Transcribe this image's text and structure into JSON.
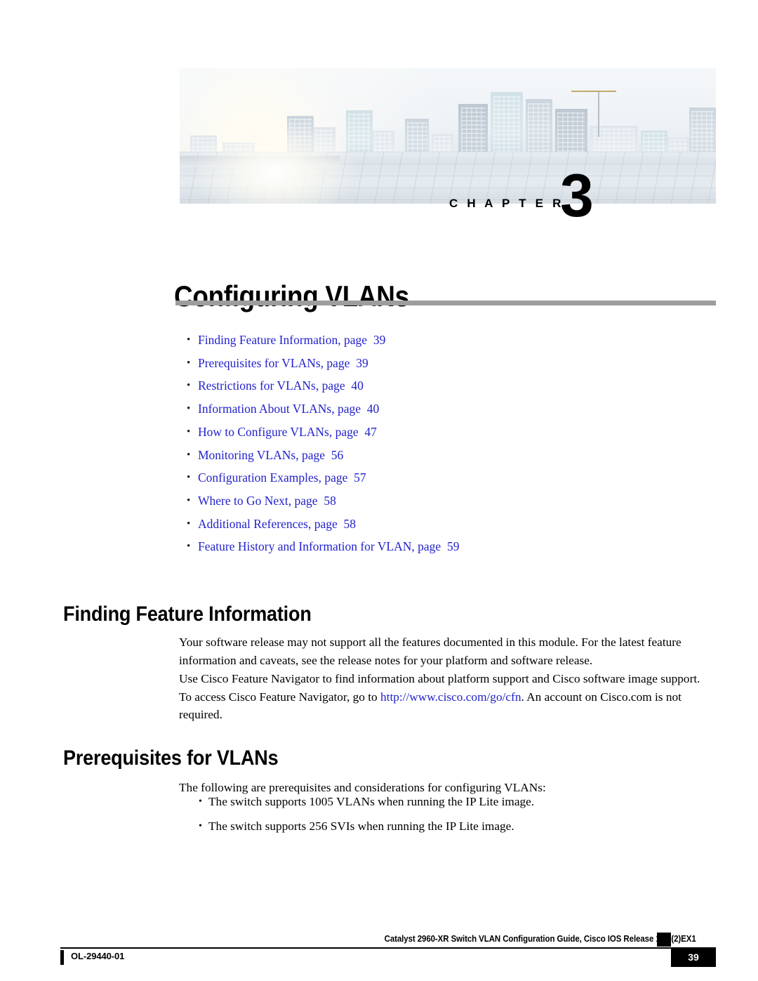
{
  "chapter": {
    "label": "C H A P T E R",
    "number": "3",
    "title": "Configuring VLANs",
    "banner_alt": "city-skyline-photo"
  },
  "toc": {
    "bullet": "•",
    "items": [
      {
        "link": "Finding Feature Information",
        "sep": ",",
        "page_word": "page",
        "page": "39"
      },
      {
        "link": "Prerequisites for VLANs",
        "sep": ",",
        "page_word": "page",
        "page": "39"
      },
      {
        "link": "Restrictions for VLANs",
        "sep": ",",
        "page_word": "page",
        "page": "40"
      },
      {
        "link": "Information About VLANs",
        "sep": ",",
        "page_word": "page",
        "page": "40"
      },
      {
        "link": "How to Configure VLANs",
        "sep": ",",
        "page_word": "page",
        "page": "47"
      },
      {
        "link": "Monitoring VLANs",
        "sep": ",",
        "page_word": "page",
        "page": "56"
      },
      {
        "link": "Configuration Examples",
        "sep": ",",
        "page_word": "page",
        "page": "57"
      },
      {
        "link": "Where to Go Next",
        "sep": ",",
        "page_word": "page",
        "page": "58"
      },
      {
        "link": "Additional References",
        "sep": ",",
        "page_word": "page",
        "page": "58"
      },
      {
        "link": "Feature History and Information for VLAN",
        "sep": ",",
        "page_word": "page",
        "page": "59"
      }
    ]
  },
  "sections": {
    "finding_feature_information": {
      "heading": "Finding Feature Information",
      "paragraph_1": "Your software release may not support all the features documented in this module. For the latest feature information and caveats, see the release notes for your platform and software release.",
      "paragraph_2_before": "Use Cisco Feature Navigator to find information about platform support and Cisco software image support. To access Cisco Feature Navigator, go to ",
      "paragraph_2_link": "http://www.cisco.com/go/cfn",
      "paragraph_2_after": ". An account on Cisco.com is not required."
    },
    "prerequisites_for_vlans": {
      "heading": "Prerequisites for VLANs",
      "intro": "The following are prerequisites and considerations for configuring VLANs:",
      "bullet": "•",
      "items": [
        "The switch supports 1005 VLANs when running the IP Lite image.",
        "The switch supports 256 SVIs when running the IP Lite image."
      ]
    }
  },
  "footer": {
    "guide_title": "Catalyst 2960-XR Switch VLAN Configuration Guide, Cisco IOS Release 15.0(2)EX1",
    "doc_id": "OL-29440-01",
    "page_number": "39"
  },
  "colors": {
    "link": "#2222cc",
    "rule_gray": "#9d9d9d",
    "text": "#000000",
    "footer_box": "#000000"
  }
}
